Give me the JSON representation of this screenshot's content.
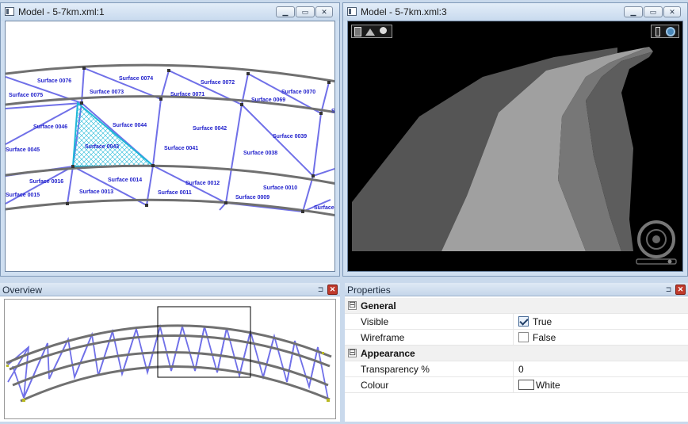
{
  "window1": {
    "title": "Model - 5-7km.xml:1"
  },
  "window2": {
    "title": "Model - 5-7km.xml:3"
  },
  "caption_buttons": {
    "minimize": "▁",
    "maximize": "▭",
    "close": "✕"
  },
  "surfaces": {
    "s0076": "Surface 0076",
    "s0074": "Surface 0074",
    "s0072": "Surface 0072",
    "s0075": "Surface 0075",
    "s0073": "Surface 0073",
    "s0071": "Surface 0071",
    "s0069": "Surface 0069",
    "s0070": "Surface 0070",
    "s0046": "Surface 0046",
    "s0044": "Surface 0044",
    "s0042": "Surface 0042",
    "s0039": "Surface 0039",
    "s0043": "Surface 0043",
    "s0045": "Surface 0045",
    "s0041": "Surface 0041",
    "s0038": "Surface 0038",
    "s0016": "Surface 0016",
    "s0014": "Surface 0014",
    "s0012": "Surface 0012",
    "s0010": "Surface 0010",
    "s0015": "Surface 0015",
    "s0013": "Surface 0013",
    "s0011": "Surface 0011",
    "s0009": "Surface 0009",
    "s_trunc_bottom": "Surface",
    "s_trunc_right": "S"
  },
  "selected_surface": "Surface 0043",
  "overview": {
    "title": "Overview"
  },
  "properties": {
    "title": "Properties",
    "categories": [
      {
        "label": "General",
        "expander": "⊟"
      },
      {
        "label": "Appearance",
        "expander": "⊟"
      }
    ],
    "rows": {
      "visible": {
        "name": "Visible",
        "value": "True",
        "checked": true
      },
      "wireframe": {
        "name": "Wireframe",
        "value": "False",
        "checked": false
      },
      "transparency": {
        "name": "Transparency %",
        "value": "0"
      },
      "colour": {
        "name": "Colour",
        "value": "White",
        "swatch": "#ffffff"
      }
    }
  },
  "colors": {
    "mesh_edges": "#7070e8",
    "curb_lines": "#707070",
    "selection": "#1fb8d8",
    "viewport_bg": "#000000",
    "mdi_background": "#c9d9ec"
  },
  "icons": {
    "viewport_tools_left": [
      "layer-icon",
      "terrain-icon",
      "light-bulb-icon"
    ],
    "viewport_tools_right": [
      "camera-marker-icon",
      "view-sphere-icon"
    ],
    "navigation": "navigation-dial-icon"
  }
}
